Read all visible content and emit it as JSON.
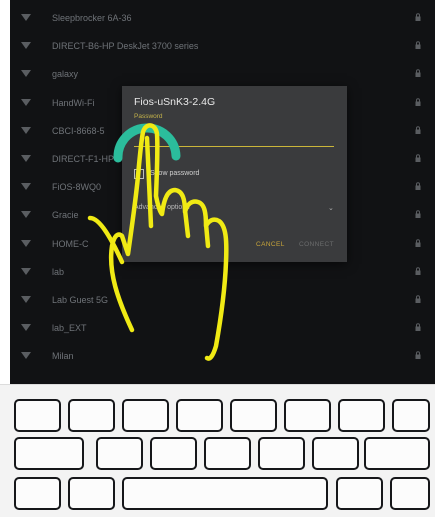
{
  "networks": [
    {
      "name": "Sleepbrocker 6A-36"
    },
    {
      "name": "DIRECT-B6-HP DeskJet 3700 series"
    },
    {
      "name": "galaxy"
    },
    {
      "name": "HandWi-Fi"
    },
    {
      "name": "CBCI-8668-5"
    },
    {
      "name": "DIRECT-F1-HP"
    },
    {
      "name": "FiOS-8WQ0"
    },
    {
      "name": "Gracie"
    },
    {
      "name": "HOME-C"
    },
    {
      "name": "lab"
    },
    {
      "name": "Lab Guest 5G"
    },
    {
      "name": "lab_EXT"
    },
    {
      "name": "Milan"
    }
  ],
  "dialog": {
    "title": "Fios-uSnK3-2.4G",
    "password_label": "Password",
    "password_value": "",
    "show_password_label": "Show password",
    "advanced_label": "Advanced options",
    "cancel_label": "CANCEL",
    "connect_label": "CONNECT"
  },
  "icons": {
    "wifi": "wifi-icon",
    "lock": "lock-icon",
    "hand": "pointing-hand-icon"
  },
  "colors": {
    "screen_bg": "#111214",
    "dialog_bg": "#3a3b3d",
    "accent_yellow": "#cbb63a",
    "tap_ring_teal": "#2bbd9c",
    "hand_outline": "#f0ea14"
  }
}
